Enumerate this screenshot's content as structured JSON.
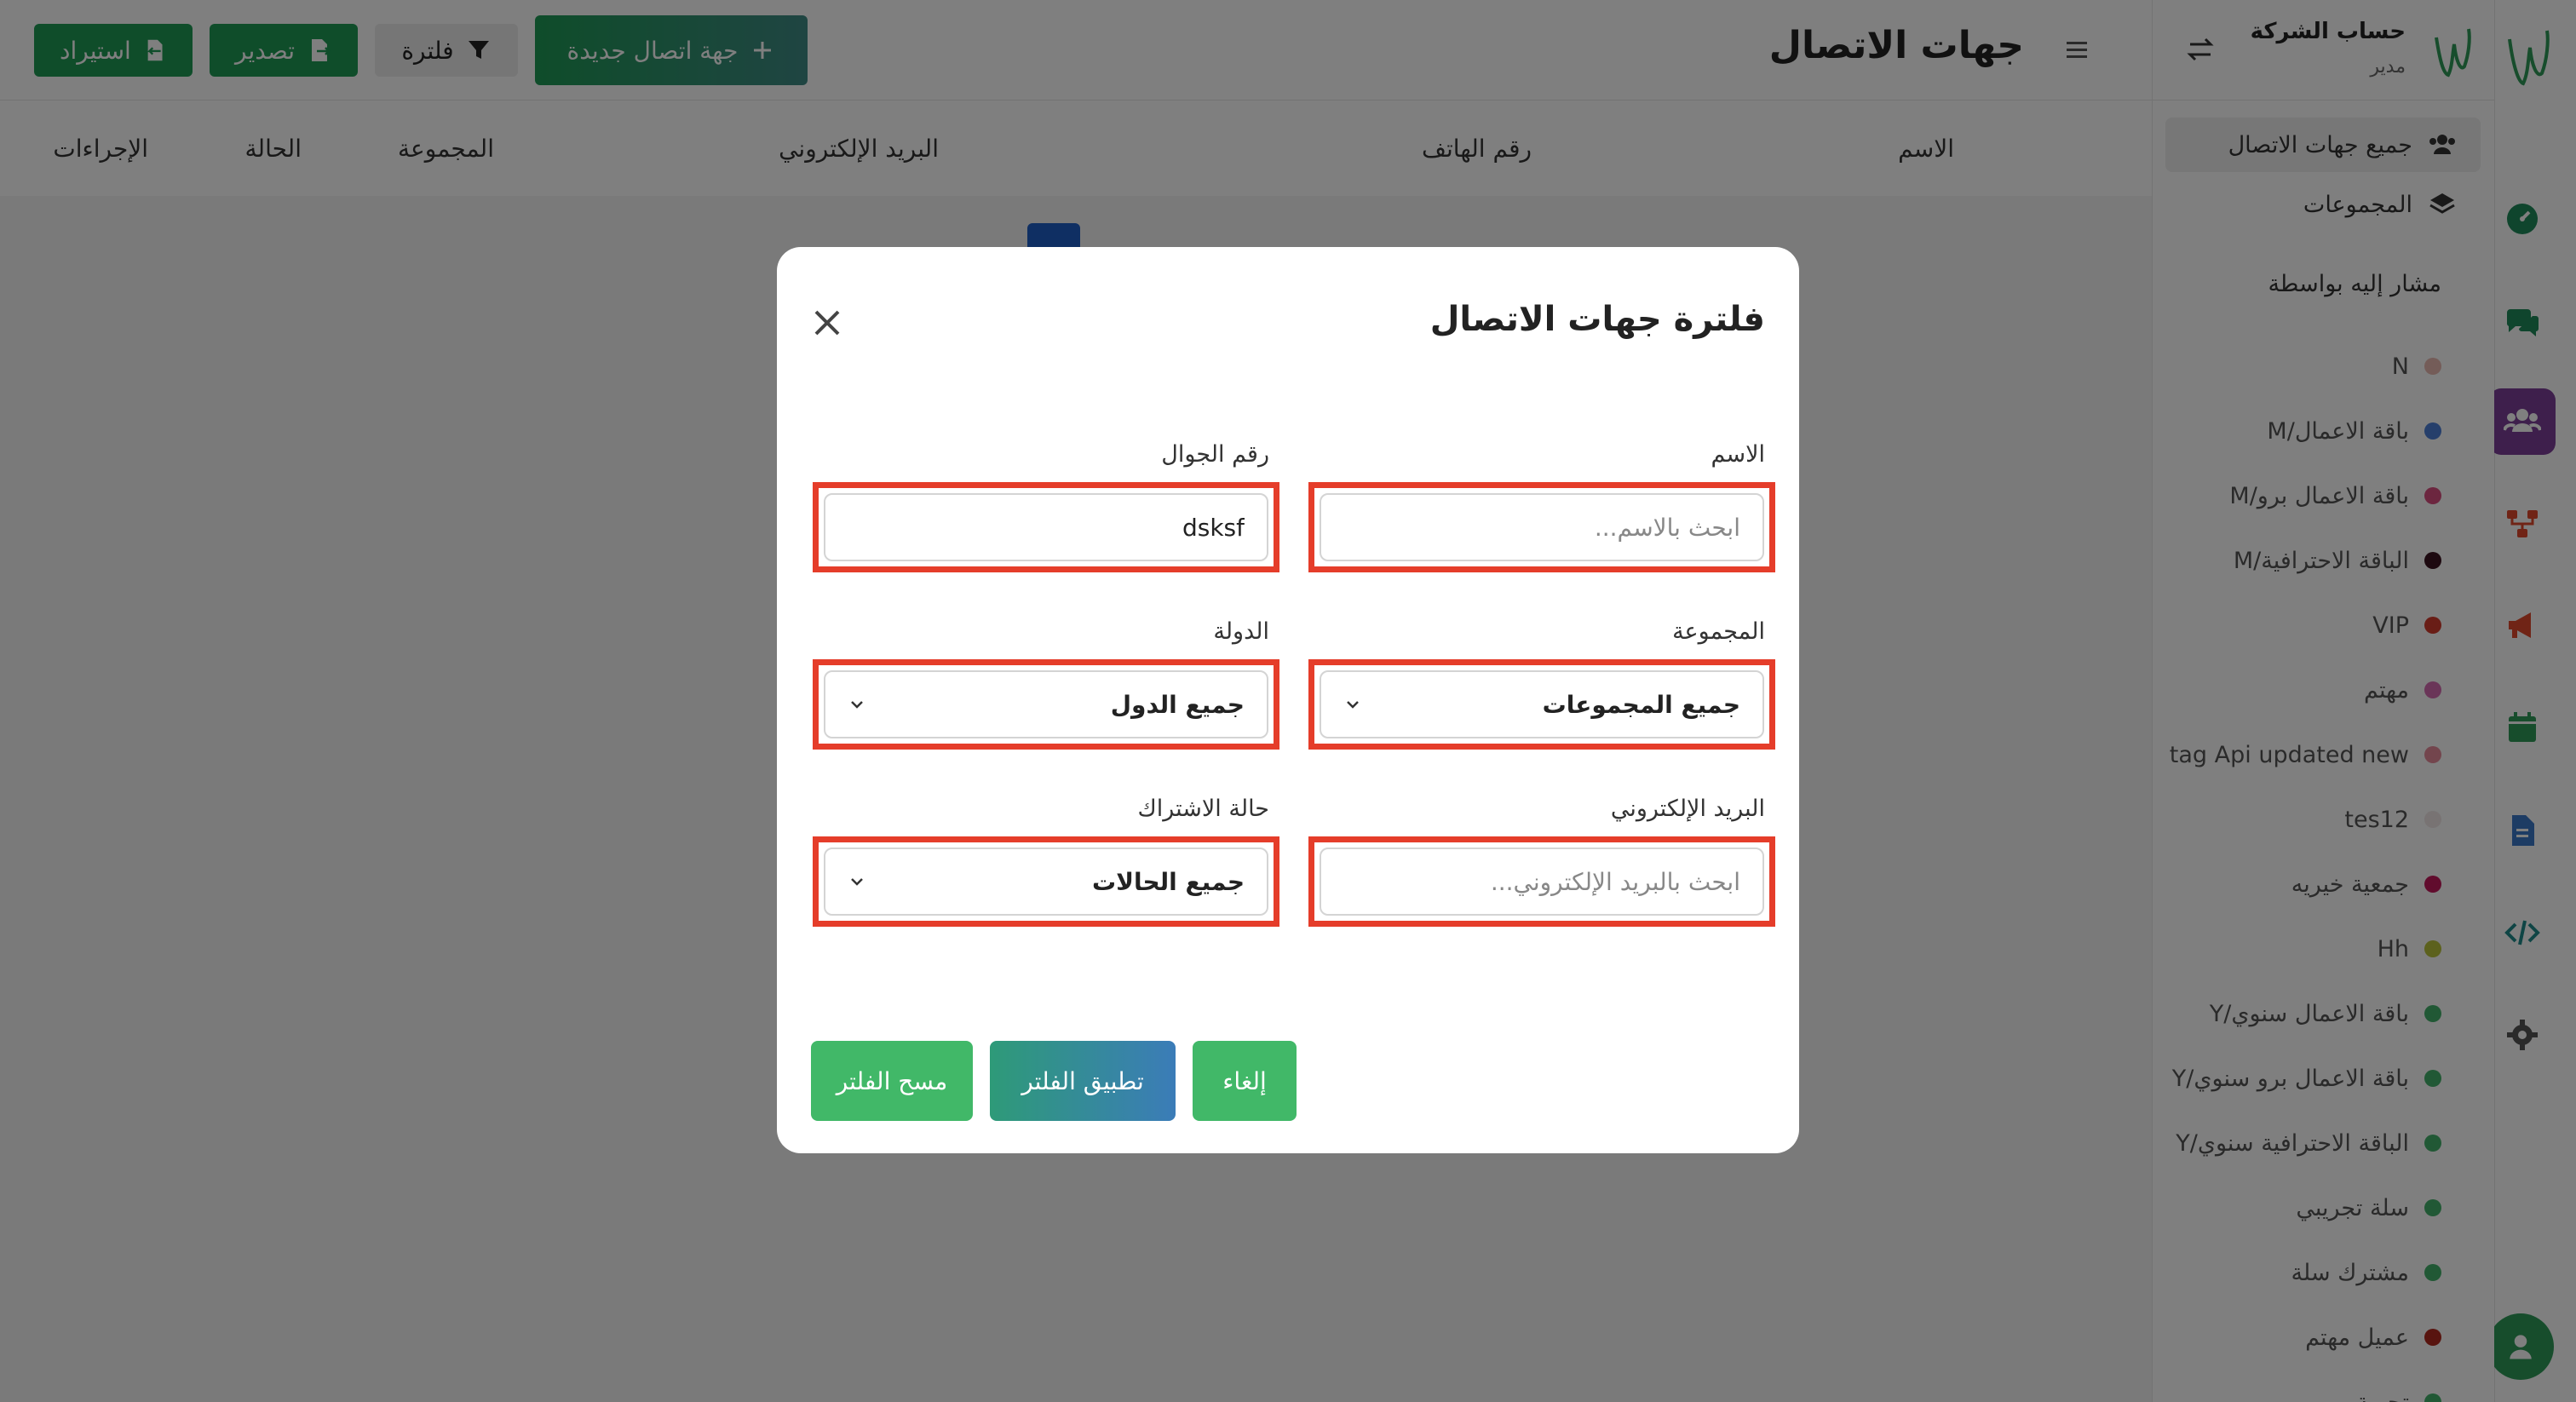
{
  "app": {
    "company_name": "حساب الشركة",
    "company_role": "مدير"
  },
  "colors": {
    "primary_green": "#1e9a55",
    "accent_purple": "#7d3f98",
    "highlight_red": "#e53d2a"
  },
  "rail": {
    "icons": [
      "dashboard-icon",
      "chat-icon",
      "contacts-icon",
      "flows-icon",
      "campaigns-icon",
      "calendar-icon",
      "document-icon",
      "code-icon",
      "settings-icon"
    ],
    "active": "contacts-icon"
  },
  "sidebar": {
    "all_contacts": "جميع جهات الاتصال",
    "groups": "المجموعات",
    "referred_by_title": "مشار إليه بواسطة",
    "tags": [
      {
        "label": "N",
        "color": "#e9b9b0"
      },
      {
        "label": "باقة الاعمال/M",
        "color": "#4d7fd6"
      },
      {
        "label": "باقة الاعمال برو/M",
        "color": "#d94c7f"
      },
      {
        "label": "الباقة الاحترافية/M",
        "color": "#3a1320"
      },
      {
        "label": "VIP",
        "color": "#d33a2c"
      },
      {
        "label": "مهتم",
        "color": "#d46ab0"
      },
      {
        "label": "tag Api updated new",
        "color": "#e68a9a"
      },
      {
        "label": "tes12",
        "color": "#f0e6e6"
      },
      {
        "label": "جمعية خيريه",
        "color": "#c2185b"
      },
      {
        "label": "Hh",
        "color": "#b8c23a"
      },
      {
        "label": "باقة الاعمال سنوي/Y",
        "color": "#43b06a"
      },
      {
        "label": "باقة الاعمال برو سنوي/Y",
        "color": "#43b06a"
      },
      {
        "label": "الباقة الاحترافية سنوي/Y",
        "color": "#43b06a"
      },
      {
        "label": "سلة تجريبي",
        "color": "#43b06a"
      },
      {
        "label": "مشترك سلة",
        "color": "#43b06a"
      },
      {
        "label": "عميل مهتم",
        "color": "#b0281e"
      },
      {
        "label": "تجربة",
        "color": "#43b06a"
      }
    ]
  },
  "header": {
    "title": "جهات الاتصال",
    "new_contact": "جهة اتصال جديدة",
    "filter": "فلترة",
    "export": "تصدير",
    "import": "استيراد"
  },
  "table": {
    "columns": [
      "الاسم",
      "رقم الهاتف",
      "البريد الإلكتروني",
      "المجموعة",
      "الحالة",
      "الإجراءات"
    ]
  },
  "modal": {
    "title": "فلترة جهات الاتصال",
    "name_label": "الاسم",
    "name_placeholder": "ابحث بالاسم...",
    "name_value": "",
    "mobile_label": "رقم الجوال",
    "mobile_value": "dsksf",
    "group_label": "المجموعة",
    "group_value": "جميع المجموعات",
    "country_label": "الدولة",
    "country_value": "جميع الدول",
    "email_label": "البريد الإلكتروني",
    "email_placeholder": "ابحث بالبريد الإلكتروني...",
    "email_value": "",
    "status_label": "حالة الاشتراك",
    "status_value": "جميع الحالات",
    "cancel": "إلغاء",
    "apply": "تطبيق الفلتر",
    "clear": "مسح الفلتر"
  }
}
